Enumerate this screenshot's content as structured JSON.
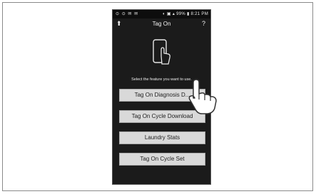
{
  "status_bar": {
    "left_icons": "⊙ ⊙ ✉ ✉",
    "right": "◐ ▣ ▴ 99% ▮ 8:21 PM"
  },
  "header": {
    "title": "Tag On",
    "back_icon": "back-icon",
    "help_icon": "help-icon",
    "help_glyph": "?",
    "back_glyph": "⬆"
  },
  "prompt": "Select the feature you want to use.",
  "buttons": [
    {
      "label": "Tag On Diagnosis D..."
    },
    {
      "label": "Tag On Cycle Download"
    },
    {
      "label": "Laundry Stats"
    },
    {
      "label": "Tag On Cycle Set"
    }
  ],
  "icons": {
    "phone_tag": "phone-nfc-icon",
    "pointer": "hand-pointer-icon"
  }
}
